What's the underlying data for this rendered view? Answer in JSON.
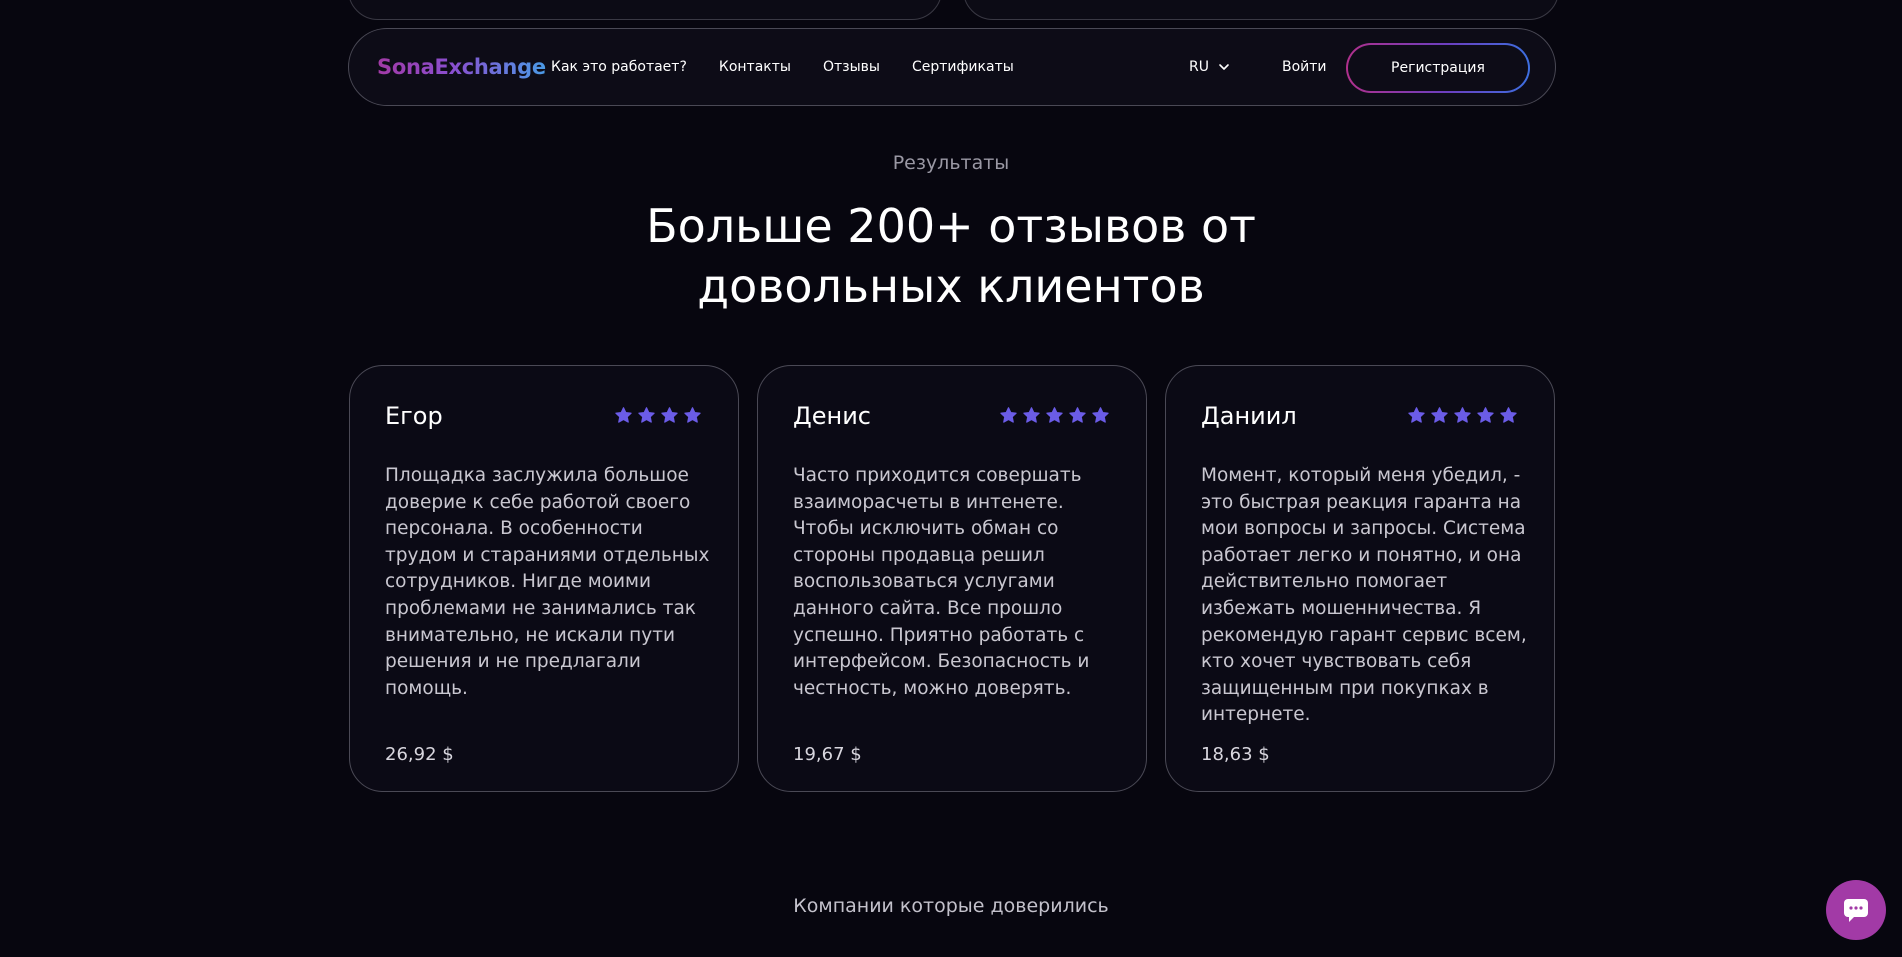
{
  "header": {
    "logo": "SonaExchange",
    "nav": [
      {
        "label": "Как это работает?"
      },
      {
        "label": "Контакты"
      },
      {
        "label": "Отзывы"
      },
      {
        "label": "Сертификаты"
      }
    ],
    "language": "RU",
    "login_label": "Войти",
    "register_label": "Регистрация"
  },
  "section": {
    "eyebrow": "Результаты",
    "headline_line1": "Больше 200+ отзывов от",
    "headline_line2": "довольных клиентов"
  },
  "reviews": [
    {
      "name": "Егор",
      "rating": 4,
      "text": "Площадка заслужила большое доверие к себе работой своего персонала. В особенности трудом и стараниями отдельных сотрудников. Нигде моими проблемами не занимались так внимательно, не искали пути решения и не предлагали помощь.",
      "amount": "26,92 $"
    },
    {
      "name": "Денис",
      "rating": 5,
      "text": "Часто приходится совершать взаиморасчеты в интенете. Чтобы исключить обман со стороны продавца решил воспользоваться услугами данного сайта. Все прошло успешно. Приятно работать с интерфейсом. Безопасность и честность, можно доверять.",
      "amount": "19,67 $"
    },
    {
      "name": "Даниил",
      "rating": 5,
      "text": "Момент, который меня убедил, - это быстрая реакция гаранта на мои вопросы и запросы. Система работает легко и понятно, и она действительно помогает избежать мошенничества. Я рекомендую гарант сервис всем, кто хочет чувствовать себя защищенным при покупках в интернете.",
      "amount": "18,63 $"
    }
  ],
  "companies_heading": "Компании которые доверились",
  "colors": {
    "background": "#07060f",
    "star": "#6b5ce7",
    "brand_gradient_start": "#a23aa6",
    "brand_gradient_end": "#4a9be6",
    "chat_button": "#a23aa6"
  },
  "icons": {
    "language_caret": "chevron-down-icon",
    "star": "star-icon",
    "chat": "chat-bubble-icon"
  }
}
